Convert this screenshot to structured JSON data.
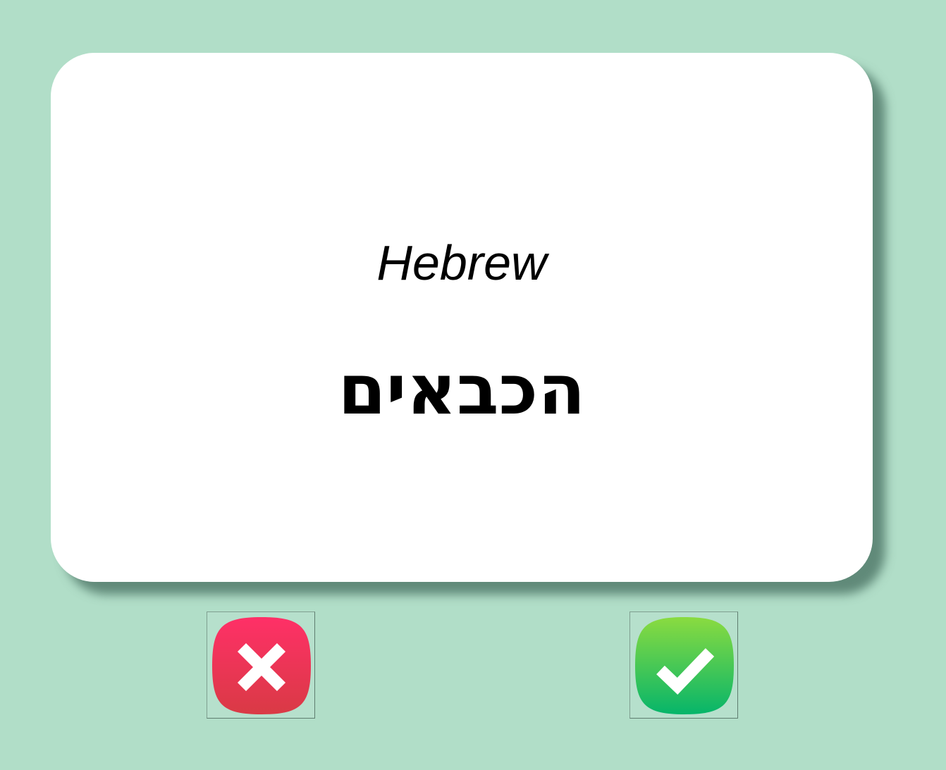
{
  "card": {
    "language": "Hebrew",
    "word": "הכבאים"
  },
  "buttons": {
    "wrong": {
      "icon": "x-mark-icon",
      "color": "#e8364f"
    },
    "right": {
      "icon": "check-mark-icon",
      "color": "#22c15c"
    }
  },
  "colors": {
    "background": "#b1dec8",
    "card": "#ffffff"
  }
}
